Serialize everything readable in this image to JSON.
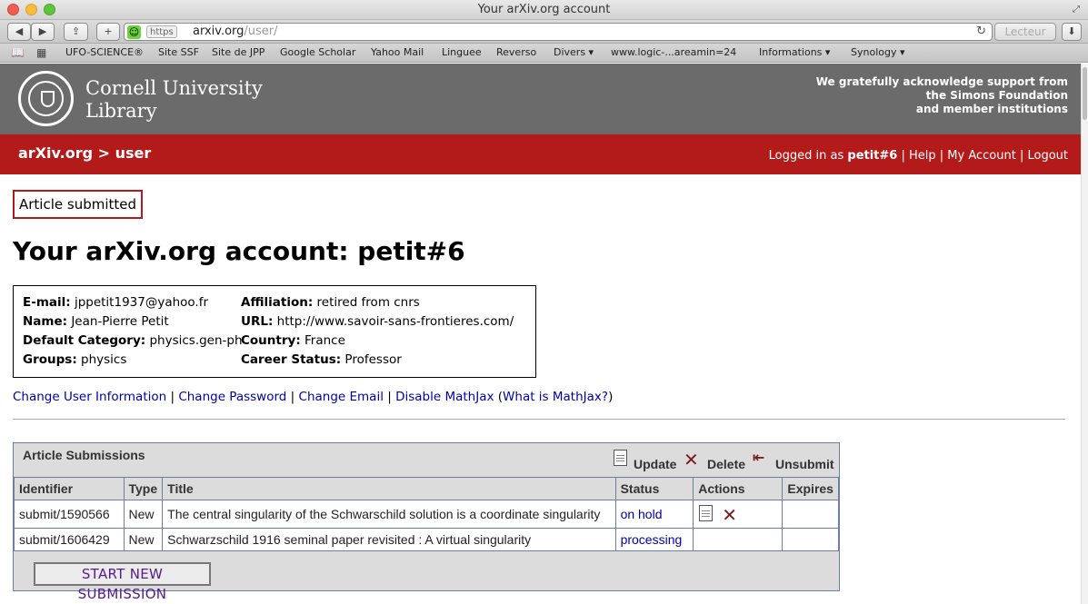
{
  "browser": {
    "window_title": "Your arXiv.org account",
    "url_scheme": "https",
    "url_domain": "arxiv.org",
    "url_path": "/user/",
    "reader_label": "Lecteur",
    "bookmarks": [
      "UFO-SCIENCE®",
      "Site SSF",
      "Site de JPP",
      "Google Scholar",
      "Yahoo Mail",
      "Linguee",
      "Reverso",
      "Divers ▾",
      "www.logic-...areamin=24",
      "Informations ▾",
      "Synology ▾"
    ]
  },
  "header": {
    "library_name_1": "Cornell University",
    "library_name_2": "Library",
    "support_1": "We gratefully acknowledge support from",
    "support_2": "the Simons Foundation",
    "support_3": "and member institutions"
  },
  "nav": {
    "breadcrumb": "arXiv.org > user",
    "logged_in_prefix": "Logged in as ",
    "username": "petit#6",
    "sep": " | ",
    "help": "Help",
    "my_account": "My Account",
    "logout": "Logout"
  },
  "page": {
    "flash": "Article submitted",
    "title": "Your arXiv.org account: petit#6"
  },
  "profile": {
    "email_label": "E-mail:",
    "email": " jppetit1937@yahoo.fr",
    "name_label": "Name:",
    "name": " Jean-Pierre Petit",
    "category_label": "Default Category:",
    "category": " physics.gen-ph",
    "groups_label": "Groups:",
    "groups": " physics",
    "affiliation_label": "Affiliation:",
    "affiliation": " retired from cnrs",
    "url_label": "URL:",
    "url": " http://www.savoir-sans-frontieres.com/",
    "country_label": "Country:",
    "country": " France",
    "career_label": "Career Status:",
    "career": " Professor"
  },
  "links": {
    "change_info": "Change User Information",
    "change_password": "Change Password",
    "change_email": "Change Email",
    "disable_mathjax": "Disable MathJax",
    "paren_open": " (",
    "what_is_mathjax": "What is MathJax?",
    "paren_close": ")",
    "sep": " | "
  },
  "submissions": {
    "title": "Article Submissions",
    "update_label": "Update",
    "delete_label": "Delete",
    "unsubmit_label": "Unsubmit",
    "columns": [
      "Identifier",
      "Type",
      "Title",
      "Status",
      "Actions",
      "Expires"
    ],
    "rows": [
      {
        "identifier": "submit/1590566",
        "type": "New",
        "title": "The central singularity of the Schwarschild solution is a coordinate singularity",
        "status": "on hold",
        "expires": ""
      },
      {
        "identifier": "submit/1606429",
        "type": "New",
        "title": "Schwarzschild 1916 seminal paper revisited : A virtual singularity",
        "status": "processing",
        "expires": ""
      }
    ],
    "new_submission": "START NEW SUBMISSION"
  },
  "icons": {
    "update": "document-edit-icon",
    "delete": "red-x-icon",
    "unsubmit": "unsubmit-arrow-icon"
  },
  "colors": {
    "arxiv_red": "#b31b1b",
    "masthead_gray": "#6b6b6b",
    "link_blue": "#0000aa",
    "table_border": "#6b7fa3"
  }
}
